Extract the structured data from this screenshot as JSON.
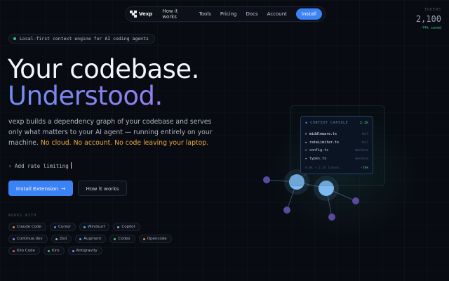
{
  "nav": {
    "logo": "Vexp",
    "links": [
      "How it works",
      "Tools",
      "Pricing",
      "Docs",
      "Account"
    ],
    "install": "Install"
  },
  "tokens": {
    "label": "TOKENS",
    "value": "2,100",
    "saved": "-74% saved"
  },
  "hero": {
    "tagline": "Local-first context engine for AI coding agents",
    "title_line1": "Your codebase.",
    "title_line2": "Understood.",
    "desc": "vexp builds a dependency graph of your codebase and serves only what matters to your AI agent — running entirely on your machine.",
    "desc_highlight": "No cloud. No account. No code leaving your laptop.",
    "command_prompt": "›",
    "command": "Add rate limiting",
    "primary_button": "Install Extension",
    "primary_icon": "arrow-right-icon",
    "secondary_button": "How it works"
  },
  "works_with": {
    "label": "WORKS WITH",
    "tools": [
      {
        "name": "Claude Code",
        "color": "#e0883a"
      },
      {
        "name": "Cursor",
        "color": "#5b8def"
      },
      {
        "name": "Windsurf",
        "color": "#3bb4c9"
      },
      {
        "name": "Copilot",
        "color": "#9aa3b4"
      },
      {
        "name": "Continue.dev",
        "color": "#9b7ff0"
      },
      {
        "name": "Zed",
        "color": "#9aa3b4"
      },
      {
        "name": "Augment",
        "color": "#5b8def"
      },
      {
        "name": "Codex",
        "color": "#37c274"
      },
      {
        "name": "Opencode",
        "color": "#e0883a"
      },
      {
        "name": "Kilo Code",
        "color": "#e05a5a"
      },
      {
        "name": "Kiro",
        "color": "#37c274"
      },
      {
        "name": "Antigravity",
        "color": "#9b7ff0"
      }
    ]
  },
  "capsule": {
    "title_marker": "◆",
    "title": "CONTEXT CAPSULE",
    "count": "2.1k",
    "files": [
      {
        "name": "middleware.ts",
        "mode": "full",
        "bright": true
      },
      {
        "name": "rateLimiter.ts",
        "mode": "full",
        "bright": true
      },
      {
        "name": "config.ts",
        "mode": "skeleton",
        "bright": false
      },
      {
        "name": "types.ts",
        "mode": "skeleton",
        "bright": false
      }
    ],
    "footer_left": "8.0k → 2.1k tokens",
    "footer_right": "-74%"
  },
  "colors": {
    "accent": "#3b82f6",
    "node_main": "#7db8f0",
    "node_small": "#5a4a9e",
    "highlight": "#e9a73a"
  }
}
